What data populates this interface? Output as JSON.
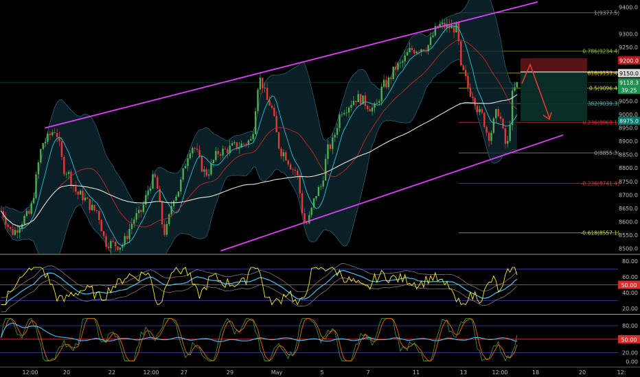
{
  "chart_data": {
    "type": "candlestick",
    "instrument_hint": "BTC",
    "price_axis": {
      "ticks": [
        "9400.0",
        "9300.0",
        "9250.0",
        "9200.0",
        "9150.0",
        "9100.0",
        "9050.0",
        "9000.0",
        "8950.0",
        "8900.0",
        "8850.0",
        "8800.0",
        "8750.0",
        "8700.0",
        "8650.0",
        "8600.0",
        "8550.0",
        "8500.0"
      ],
      "range": [
        8490,
        9410
      ]
    },
    "price_badges": [
      {
        "label": "9200.0",
        "color": "#b71c1c"
      },
      {
        "label": "9150.0",
        "color": "#d9d9d9"
      },
      {
        "label": "9118.3",
        "color": "#1e8f4e"
      },
      {
        "label": "39:25",
        "color": "#1e8f4e"
      },
      {
        "label": "8975.0",
        "color": "#00796b"
      }
    ],
    "fib_levels_upper": [
      {
        "label": "1(9377.5)",
        "price": 9377.5,
        "color": "#9e9e9e"
      },
      {
        "label": "0.786(9234.4)",
        "price": 9234.4,
        "color": "#8bc34a"
      },
      {
        "label": "0.618(9153.4)",
        "price": 9153.4,
        "color": "#e6c229"
      },
      {
        "label": "0.5(9096.4)",
        "price": 9096.4,
        "color": "#d4e157"
      },
      {
        "label": "0.382(9039.3)",
        "price": 9039.3,
        "color": "#4db6ac"
      },
      {
        "label": "0.236(8969.1)",
        "price": 8969.1,
        "color": "#e53935"
      },
      {
        "label": "0(8855.3)",
        "price": 8855.3,
        "color": "#9e9e9e"
      },
      {
        "label": "-0.236(8741.4)",
        "price": 8741.4,
        "color": "#e53935"
      },
      {
        "label": "-0.618(8557.1)",
        "price": 8557.1,
        "color": "#cddc39"
      }
    ],
    "time_axis": [
      "12:00",
      "20",
      "22",
      "12:00",
      "27",
      "29",
      "May",
      "5",
      "7",
      "11",
      "13",
      "12:00",
      "18",
      "20",
      "12:"
    ],
    "channel": {
      "upper": [
        [
          0.07,
          8948
        ],
        [
          0.84,
          9418
        ]
      ],
      "lower": [
        [
          0.345,
          8490
        ],
        [
          0.88,
          8922
        ]
      ],
      "color": "#e040fb"
    },
    "indicator_rsi": {
      "ticks": [
        "80.00",
        "60.00",
        "50.00",
        "40.00",
        "20.00"
      ],
      "range": [
        15,
        85
      ],
      "level_label": "50.00",
      "levels": [
        70,
        50,
        30
      ]
    },
    "indicator_stoch": {
      "ticks": [
        "80.00",
        "50.00",
        "20.00",
        "0.00"
      ],
      "range": [
        -8,
        100
      ],
      "level_label": "50.00",
      "levels": [
        80,
        50,
        20
      ]
    }
  }
}
